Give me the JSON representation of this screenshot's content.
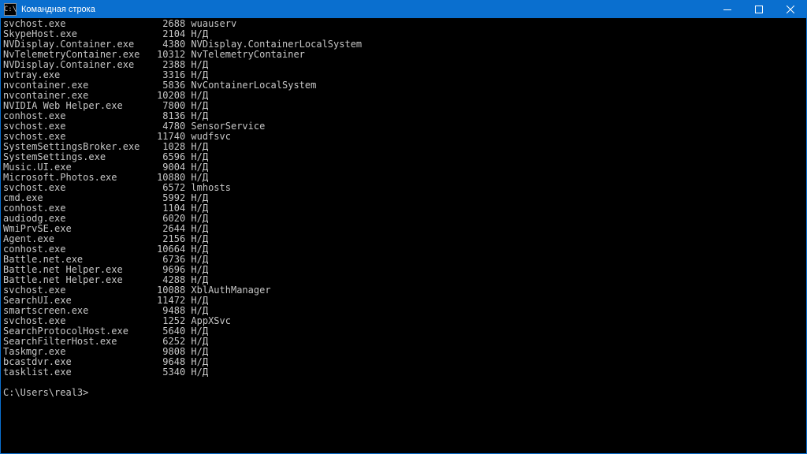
{
  "titlebar": {
    "icon_label": "C:\\",
    "title": "Командная строка"
  },
  "columns": {
    "name_width": 25,
    "pid_width": 6
  },
  "rows": [
    {
      "name": "svchost.exe",
      "pid": 2688,
      "svc": "wuauserv"
    },
    {
      "name": "SkypeHost.exe",
      "pid": 2104,
      "svc": "Н/Д"
    },
    {
      "name": "NVDisplay.Container.exe",
      "pid": 4380,
      "svc": "NVDisplay.ContainerLocalSystem"
    },
    {
      "name": "NvTelemetryContainer.exe",
      "pid": 10312,
      "svc": "NvTelemetryContainer"
    },
    {
      "name": "NVDisplay.Container.exe",
      "pid": 2388,
      "svc": "Н/Д"
    },
    {
      "name": "nvtray.exe",
      "pid": 3316,
      "svc": "Н/Д"
    },
    {
      "name": "nvcontainer.exe",
      "pid": 5836,
      "svc": "NvContainerLocalSystem"
    },
    {
      "name": "nvcontainer.exe",
      "pid": 10208,
      "svc": "Н/Д"
    },
    {
      "name": "NVIDIA Web Helper.exe",
      "pid": 7800,
      "svc": "Н/Д"
    },
    {
      "name": "conhost.exe",
      "pid": 8136,
      "svc": "Н/Д"
    },
    {
      "name": "svchost.exe",
      "pid": 4780,
      "svc": "SensorService"
    },
    {
      "name": "svchost.exe",
      "pid": 11740,
      "svc": "wudfsvc"
    },
    {
      "name": "SystemSettingsBroker.exe",
      "pid": 1028,
      "svc": "Н/Д"
    },
    {
      "name": "SystemSettings.exe",
      "pid": 6596,
      "svc": "Н/Д"
    },
    {
      "name": "Music.UI.exe",
      "pid": 9004,
      "svc": "Н/Д"
    },
    {
      "name": "Microsoft.Photos.exe",
      "pid": 10880,
      "svc": "Н/Д"
    },
    {
      "name": "svchost.exe",
      "pid": 6572,
      "svc": "lmhosts"
    },
    {
      "name": "cmd.exe",
      "pid": 5992,
      "svc": "Н/Д"
    },
    {
      "name": "conhost.exe",
      "pid": 1104,
      "svc": "Н/Д"
    },
    {
      "name": "audiodg.exe",
      "pid": 6020,
      "svc": "Н/Д"
    },
    {
      "name": "WmiPrvSE.exe",
      "pid": 2644,
      "svc": "Н/Д"
    },
    {
      "name": "Agent.exe",
      "pid": 2156,
      "svc": "Н/Д"
    },
    {
      "name": "conhost.exe",
      "pid": 10664,
      "svc": "Н/Д"
    },
    {
      "name": "Battle.net.exe",
      "pid": 6736,
      "svc": "Н/Д"
    },
    {
      "name": "Battle.net Helper.exe",
      "pid": 9696,
      "svc": "Н/Д"
    },
    {
      "name": "Battle.net Helper.exe",
      "pid": 4288,
      "svc": "Н/Д"
    },
    {
      "name": "svchost.exe",
      "pid": 10088,
      "svc": "XblAuthManager"
    },
    {
      "name": "SearchUI.exe",
      "pid": 11472,
      "svc": "Н/Д"
    },
    {
      "name": "smartscreen.exe",
      "pid": 9488,
      "svc": "Н/Д"
    },
    {
      "name": "svchost.exe",
      "pid": 1252,
      "svc": "AppXSvc"
    },
    {
      "name": "SearchProtocolHost.exe",
      "pid": 5640,
      "svc": "Н/Д"
    },
    {
      "name": "SearchFilterHost.exe",
      "pid": 6252,
      "svc": "Н/Д"
    },
    {
      "name": "Taskmgr.exe",
      "pid": 9808,
      "svc": "Н/Д"
    },
    {
      "name": "bcastdvr.exe",
      "pid": 9648,
      "svc": "Н/Д"
    },
    {
      "name": "tasklist.exe",
      "pid": 5340,
      "svc": "Н/Д"
    }
  ],
  "prompt": "C:\\Users\\real3>"
}
